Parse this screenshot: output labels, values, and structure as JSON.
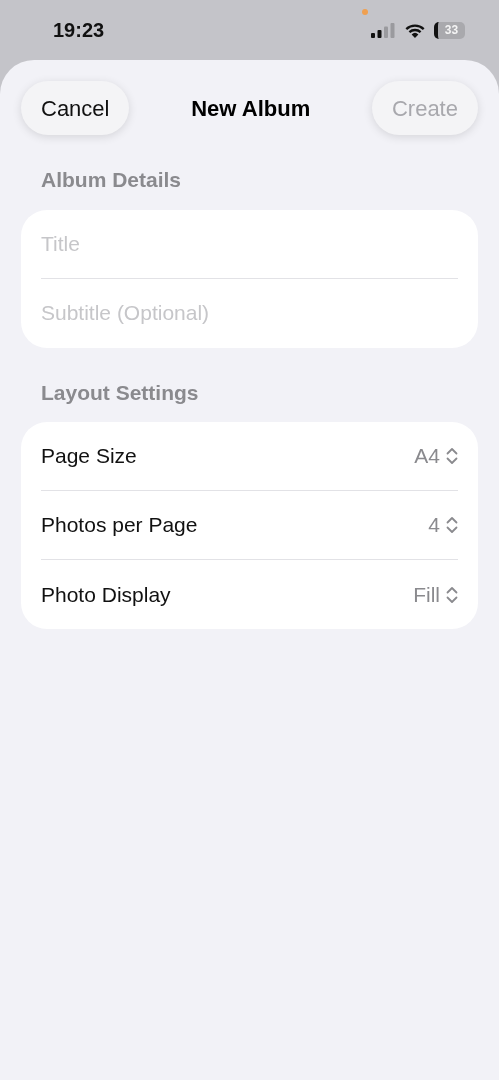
{
  "status_bar": {
    "time": "19:23",
    "battery": "33"
  },
  "nav": {
    "cancel": "Cancel",
    "title": "New Album",
    "create": {
      "label": "Create",
      "disabled": true
    }
  },
  "sections": [
    {
      "header": "Album Details",
      "rows": [
        {
          "kind": "field",
          "placeholder": "Title"
        },
        {
          "kind": "field",
          "placeholder": "Subtitle (Optional)"
        }
      ]
    },
    {
      "header": "Layout Settings",
      "rows": [
        {
          "kind": "picker",
          "label": "Page Size",
          "value": "A4"
        },
        {
          "kind": "picker",
          "label": "Photos per Page",
          "value": "4"
        },
        {
          "kind": "picker",
          "label": "Photo Display",
          "value": "Fill"
        }
      ]
    }
  ]
}
